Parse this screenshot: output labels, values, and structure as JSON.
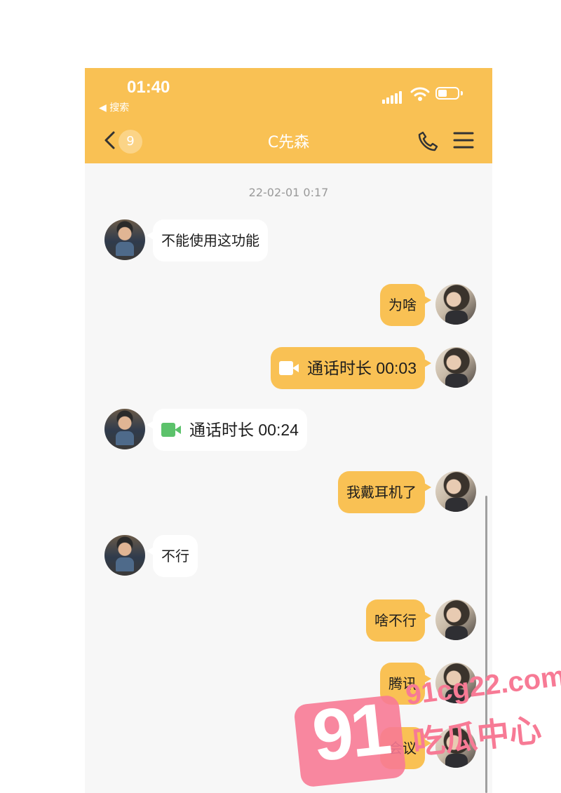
{
  "status_bar": {
    "time": "01:40",
    "back_to_app": "◀ 搜索"
  },
  "nav": {
    "unread_count": "9",
    "contact_name": "C先森"
  },
  "chat": {
    "timestamp": "22-02-01 0:17",
    "messages": [
      {
        "from": "contact",
        "type": "text",
        "text": "不能使用这功能"
      },
      {
        "from": "me",
        "type": "text",
        "text": "为啥"
      },
      {
        "from": "me",
        "type": "call",
        "text": "通话时长 00:03"
      },
      {
        "from": "contact",
        "type": "call",
        "text": "通话时长 00:24"
      },
      {
        "from": "me",
        "type": "text",
        "text": "我戴耳机了"
      },
      {
        "from": "contact",
        "type": "text",
        "text": "不行"
      },
      {
        "from": "me",
        "type": "text",
        "text": "啥不行"
      },
      {
        "from": "me",
        "type": "text",
        "text": "腾讯"
      },
      {
        "from": "me",
        "type": "text",
        "text": "会议"
      }
    ]
  },
  "watermark": {
    "number": "91",
    "url": "91cg22.com",
    "name": "吃瓜中心"
  },
  "colors": {
    "header": "#f9c154",
    "outgoing_bubble": "#f9c154",
    "incoming_bubble": "#ffffff",
    "chat_background": "#f7f7f7",
    "video_call_icon": "#5cc26b",
    "watermark": "#f77a95"
  },
  "icons": {
    "signal": "signal-icon",
    "wifi": "wifi-icon",
    "battery": "battery-icon",
    "back": "chevron-left-icon",
    "call": "phone-icon",
    "menu": "menu-icon",
    "video_call": "video-camera-icon"
  }
}
